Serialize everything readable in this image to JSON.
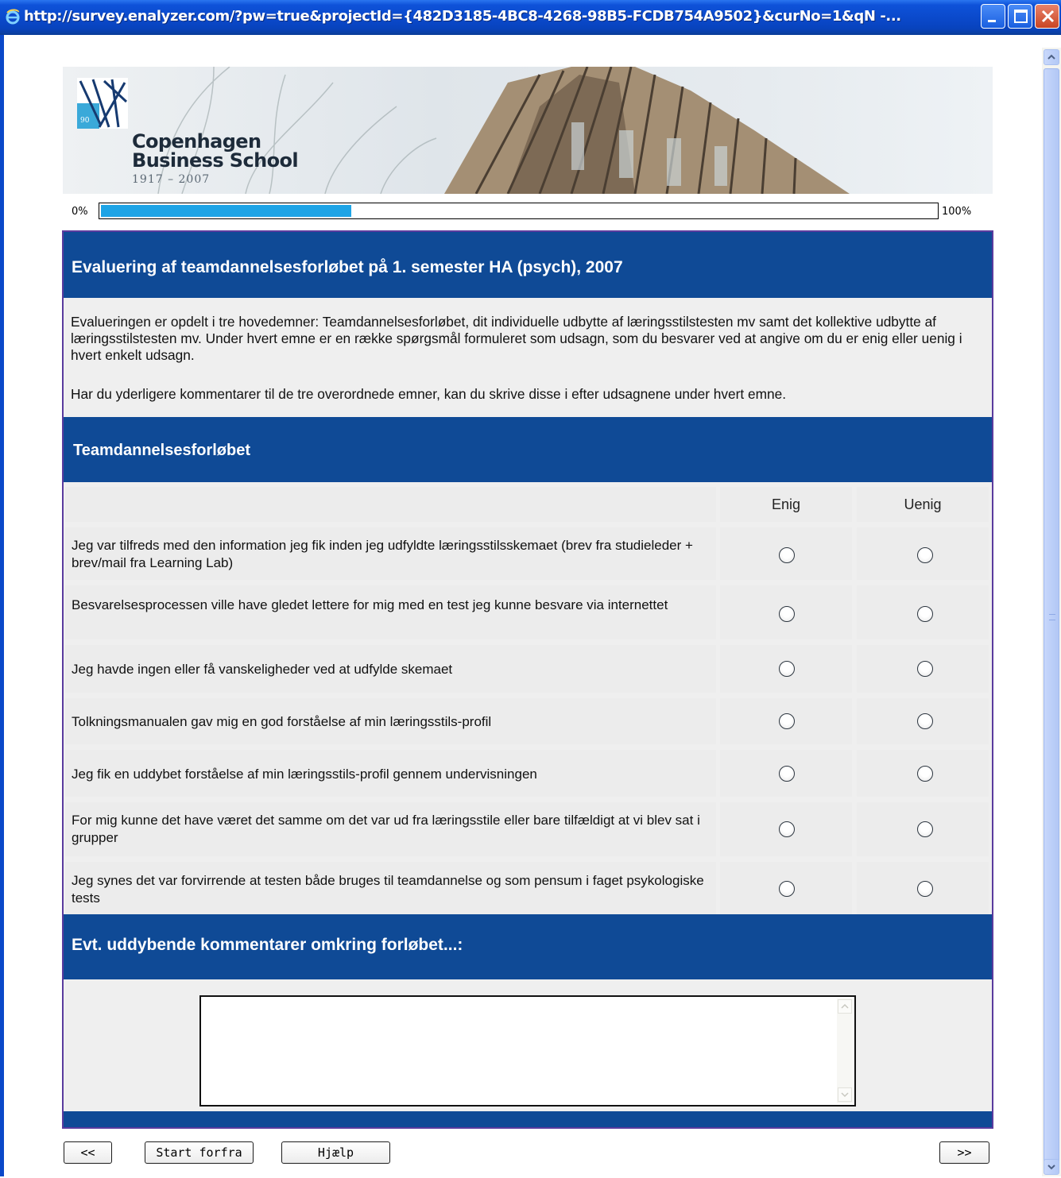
{
  "window": {
    "title": "http://survey.enalyzer.com/?pw=true&projectId={482D3185-4BC8-4268-98B5-FCDB754A9502}&curNo=1&qN -...",
    "icon": "ie-icon"
  },
  "banner": {
    "org_line1": "Copenhagen",
    "org_line2": "Business School",
    "years": "1917 – 2007"
  },
  "progress": {
    "min_label": "0%",
    "max_label": "100%",
    "value_fraction": 0.3
  },
  "survey": {
    "title": "Evaluering af teamdannelsesforløbet på 1. semester HA (psych), 2007",
    "intro_p1": "Evalueringen er opdelt i tre hovedemner: Teamdannelsesforløbet, dit individuelle udbytte af læringsstilstesten mv samt det kollektive udbytte af læringsstilstesten mv. Under hvert emne er en række spørgsmål formuleret som udsagn, som du besvarer ved at angive om du er enig eller uenig i hvert enkelt udsagn.",
    "intro_p2": "Har du yderligere kommentarer til de tre overordnede emner, kan du skrive disse i efter udsagnene under hvert emne.",
    "section_title": "Teamdannelsesforløbet",
    "columns": [
      "Enig",
      "Uenig"
    ],
    "questions": [
      {
        "text": "Jeg var tilfreds med den information jeg fik inden jeg udfyldte læringsstilsskemaet (brev fra studieleder + brev/mail fra Learning Lab)",
        "answer": null
      },
      {
        "text": "Besvarelsesprocessen ville have gledet lettere for mig med en test jeg kunne besvare via internettet",
        "answer": null
      },
      {
        "text": "Jeg havde ingen eller få vanskeligheder ved at udfylde skemaet",
        "answer": null
      },
      {
        "text": "Tolkningsmanualen gav mig en god forståelse af min læringsstils-profil",
        "answer": null
      },
      {
        "text": "Jeg fik en uddybet forståelse af min læringsstils-profil gennem undervisningen",
        "answer": null
      },
      {
        "text": "For mig kunne det have været det samme om det var ud fra læringsstile eller bare tilfældigt at vi blev sat i grupper",
        "answer": null
      },
      {
        "text": "Jeg synes det var forvirrende at testen både bruges til teamdannelse og som pensum i faget psykologiske tests",
        "answer": null
      }
    ],
    "comment_title": "Evt. uddybende kommentarer omkring forløbet...:",
    "comment_value": ""
  },
  "nav": {
    "back": "<<",
    "restart": "Start forfra",
    "help": "Hjælp",
    "next": ">>"
  },
  "colors": {
    "header_band": "#0f4a96",
    "progress_fill": "#1ea4e6",
    "frame_border": "#5a3b9e"
  }
}
